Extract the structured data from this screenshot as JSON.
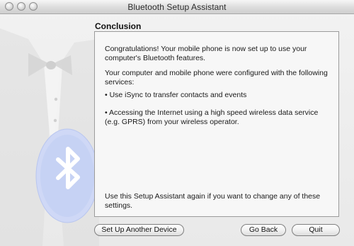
{
  "window": {
    "title": "Bluetooth Setup Assistant"
  },
  "section": {
    "heading": "Conclusion"
  },
  "content": {
    "p1": "Congratulations! Your mobile phone is now set up to use your computer's Bluetooth features.",
    "p2": "Your computer and mobile phone were configured with the following services:",
    "bullet1": "• Use iSync to transfer contacts and events",
    "bullet2": "• Accessing the Internet using a high speed wireless data service (e.g. GPRS) from your wireless operator.",
    "p3": "Use this Setup Assistant again if you want to change any of these settings."
  },
  "buttons": {
    "setup_another": "Set Up Another Device",
    "go_back": "Go Back",
    "quit": "Quit"
  },
  "icons": {
    "window_close": "close-icon",
    "window_minimize": "minimize-icon",
    "window_zoom": "zoom-icon",
    "bluetooth_logo": "bluetooth-icon",
    "tuxedo_art": "tuxedo-illustration"
  },
  "colors": {
    "titlebar_text": "#2b2b2b",
    "content_bg": "#f7f7f7",
    "border": "#9b9b9b"
  }
}
